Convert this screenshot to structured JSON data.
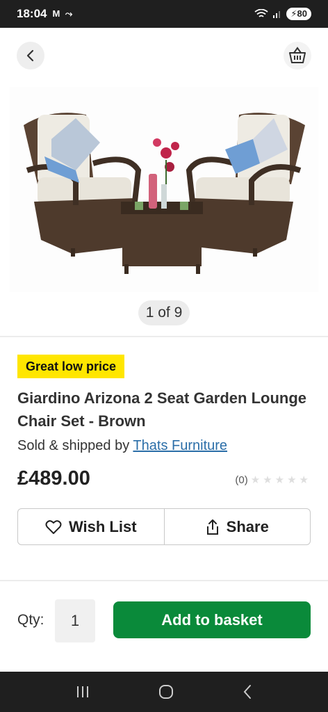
{
  "status": {
    "time": "18:04",
    "left_icons": "M ⤳",
    "battery": "80"
  },
  "gallery": {
    "counter": "1 of 9"
  },
  "product": {
    "badge": "Great low price",
    "title": "Giardino Arizona 2 Seat Garden Lounge Chair Set - Brown",
    "sold_by_prefix": "Sold & shipped by ",
    "seller": "Thats Furniture",
    "price": "£489.00",
    "rating_count": "(0)",
    "rating": 0,
    "rating_max": 5
  },
  "actions": {
    "wishlist": "Wish List",
    "share": "Share"
  },
  "purchase": {
    "qty_label": "Qty:",
    "qty_value": "1",
    "add_label": "Add to basket"
  },
  "colors": {
    "accent_green": "#0a8a3a",
    "badge_yellow": "#ffe600",
    "link_blue": "#2b6ea8"
  },
  "icons": [
    "back-chevron-icon",
    "basket-icon",
    "heart-icon",
    "share-icon",
    "recents-icon",
    "home-icon",
    "system-back-icon"
  ]
}
